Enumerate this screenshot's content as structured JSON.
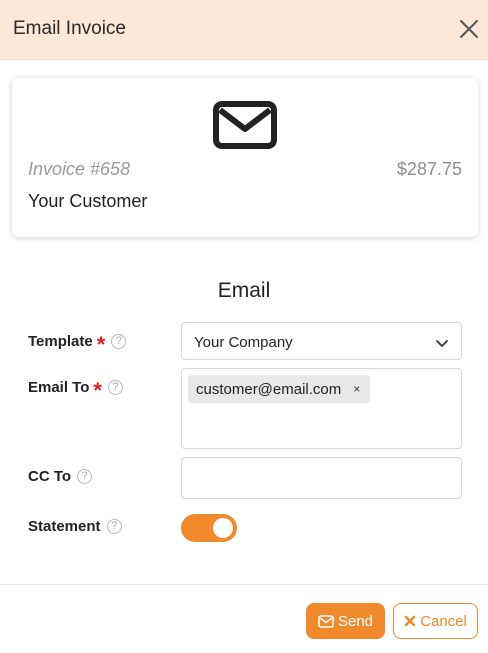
{
  "header": {
    "title": "Email Invoice",
    "close_icon": "close-icon"
  },
  "invoice_card": {
    "icon": "envelope-icon",
    "invoice_number": "Invoice #658",
    "amount": "$287.75",
    "customer": "Your Customer"
  },
  "form": {
    "section_title": "Email",
    "template": {
      "label": "Template",
      "required": true,
      "value": "Your Company"
    },
    "email_to": {
      "label": "Email To",
      "required": true,
      "tags": [
        "customer@email.com"
      ],
      "remove_glyph": "×"
    },
    "cc_to": {
      "label": "CC To",
      "value": ""
    },
    "statement": {
      "label": "Statement",
      "enabled": true
    },
    "required_marker": "*",
    "help_glyph": "?"
  },
  "footer": {
    "send_label": "Send",
    "cancel_label": "Cancel"
  },
  "colors": {
    "accent": "#f08a2c",
    "header_bg": "#fde7d6",
    "required": "#e02020"
  }
}
